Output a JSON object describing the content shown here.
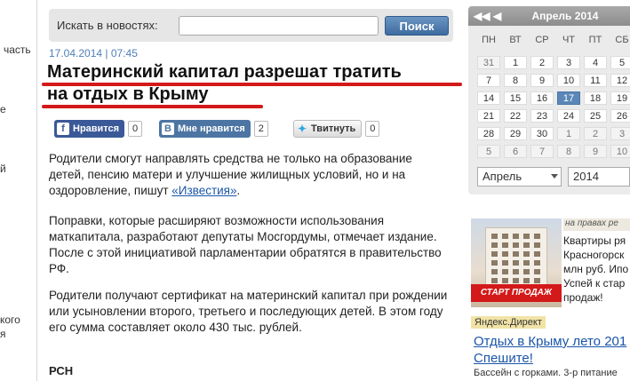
{
  "left_fragments": [
    "часть",
    "е",
    "й",
    "кого",
    "я"
  ],
  "search": {
    "label": "Искать в новостях:",
    "value": "",
    "button": "Поиск"
  },
  "article": {
    "date": "17.04.2014 | 07:45",
    "title_line1": "Материнский капитал разрешат тратить",
    "title_line2": "на отдых в Крыму",
    "paragraphs": [
      "Родители смогут направлять средства не только на образование детей, пенсию матери и улучшение жилищных условий, но и на оздоровление, пишут ",
      "Поправки, которые расширяют возможности использования маткапитала, разработают депутаты Мосгордумы, отмечает издание. После с этой инициативой парламентарии обратятся в правительство РФ.",
      "Родители получают сертификат на материнский капитал при рождении или усыновлении второго, третьего и последующих детей. В этом году его сумма составляет около 430 тыс. рублей."
    ],
    "p1_link": "«Известия»",
    "p1_end": ".",
    "source": "РСН"
  },
  "social": {
    "fb_label": "Нравится",
    "fb_count": "0",
    "vk_label": "Мне нравится",
    "vk_count": "2",
    "tw_label": "Твитнуть",
    "tw_count": "0"
  },
  "calendar": {
    "title": "Апрель 2014",
    "weekdays": [
      "ПН",
      "ВТ",
      "СР",
      "ЧТ",
      "ПТ",
      "СБ"
    ],
    "weeks": [
      [
        "31",
        "1",
        "2",
        "3",
        "4",
        "5"
      ],
      [
        "7",
        "8",
        "9",
        "10",
        "11",
        "12"
      ],
      [
        "14",
        "15",
        "16",
        "17",
        "18",
        "19"
      ],
      [
        "21",
        "22",
        "23",
        "24",
        "25",
        "26"
      ],
      [
        "28",
        "29",
        "30",
        "1",
        "2",
        "3"
      ],
      [
        "5",
        "6",
        "7",
        "8",
        "9",
        "10"
      ]
    ],
    "today": "17",
    "month_select": "Апрель",
    "year_select": "2014"
  },
  "ad": {
    "tag": "на правах ре",
    "banner": "СТАРТ ПРОДАЖ",
    "text": "Квартиры ря\nКрасногорск\nмлн руб. Ипо\nУспей к стар\nпродаж!"
  },
  "direct": {
    "label": "Яндекс.Директ",
    "link": "Отдых в Крыму лето 201\nСпешите!",
    "sub": "Бассейн с горками. 3-р питание"
  },
  "colors": {
    "accent": "#4e7fb8",
    "underline": "#d31919",
    "calendar_today": "#5b87b8"
  }
}
